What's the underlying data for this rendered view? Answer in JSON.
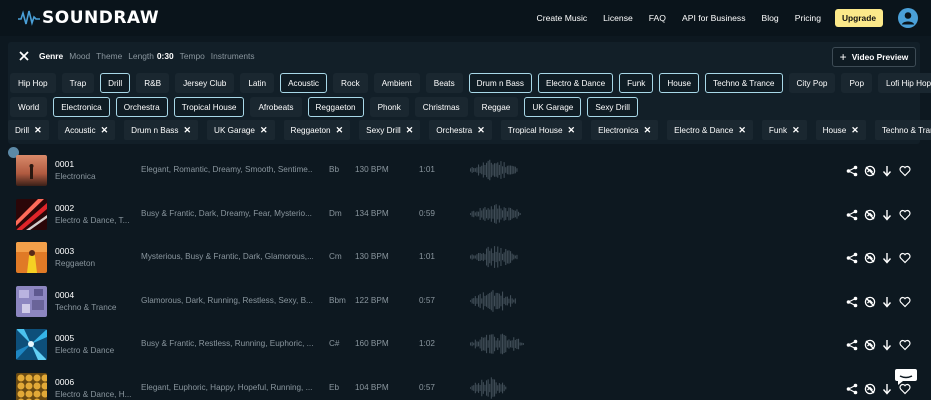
{
  "header": {
    "logo_text": "SOUNDRAW",
    "nav": [
      "Create Music",
      "License",
      "FAQ",
      "API for Business",
      "Blog",
      "Pricing"
    ],
    "upgrade_label": "Upgrade"
  },
  "filter": {
    "tabs": [
      "Genre",
      "Mood",
      "Theme",
      "Length",
      "Tempo",
      "Instruments"
    ],
    "length_value": "0:30",
    "video_preview_label": "Video Preview",
    "genre_row1": [
      {
        "label": "Hip Hop",
        "selected": false
      },
      {
        "label": "Trap",
        "selected": false
      },
      {
        "label": "Drill",
        "selected": true
      },
      {
        "label": "R&B",
        "selected": false
      },
      {
        "label": "Jersey Club",
        "selected": false
      },
      {
        "label": "Latin",
        "selected": false
      },
      {
        "label": "Acoustic",
        "selected": true
      },
      {
        "label": "Rock",
        "selected": false
      },
      {
        "label": "Ambient",
        "selected": false
      },
      {
        "label": "Beats",
        "selected": false
      },
      {
        "label": "Drum n Bass",
        "selected": true
      },
      {
        "label": "Electro & Dance",
        "selected": true
      },
      {
        "label": "Funk",
        "selected": true
      },
      {
        "label": "House",
        "selected": true
      },
      {
        "label": "Techno & Trance",
        "selected": true
      },
      {
        "label": "City Pop",
        "selected": false
      },
      {
        "label": "Pop",
        "selected": false
      },
      {
        "label": "Lofi Hip Hop",
        "selected": false
      }
    ],
    "genre_row2": [
      {
        "label": "World",
        "selected": false
      },
      {
        "label": "Electronica",
        "selected": true
      },
      {
        "label": "Orchestra",
        "selected": true
      },
      {
        "label": "Tropical House",
        "selected": true
      },
      {
        "label": "Afrobeats",
        "selected": false
      },
      {
        "label": "Reggaeton",
        "selected": true
      },
      {
        "label": "Phonk",
        "selected": false
      },
      {
        "label": "Christmas",
        "selected": false
      },
      {
        "label": "Reggae",
        "selected": false
      },
      {
        "label": "UK Garage",
        "selected": true
      },
      {
        "label": "Sexy Drill",
        "selected": true
      }
    ]
  },
  "active_filters": [
    "Drill",
    "Acoustic",
    "Drum n Bass",
    "UK Garage",
    "Reggaeton",
    "Sexy Drill",
    "Orchestra",
    "Tropical House",
    "Electronica",
    "Electro & Dance",
    "Funk",
    "House",
    "Techno & Trance"
  ],
  "tracks": [
    {
      "num": "0001",
      "genre": "Electronica",
      "moods": "Elegant, Romantic, Dreamy, Smooth, Sentime...",
      "key": "Bb",
      "bpm": "130 BPM",
      "length": "1:01",
      "thumb": "t1"
    },
    {
      "num": "0002",
      "genre": "Electro & Dance, T...",
      "moods": "Busy & Frantic, Dark, Dreamy, Fear, Mysterio...",
      "key": "Dm",
      "bpm": "134 BPM",
      "length": "0:59",
      "thumb": "t2"
    },
    {
      "num": "0003",
      "genre": "Reggaeton",
      "moods": "Mysterious, Busy & Frantic, Dark, Glamorous,...",
      "key": "Cm",
      "bpm": "130 BPM",
      "length": "1:01",
      "thumb": "t3"
    },
    {
      "num": "0004",
      "genre": "Techno & Trance",
      "moods": "Glamorous, Dark, Running, Restless, Sexy, B...",
      "key": "Bbm",
      "bpm": "122 BPM",
      "length": "0:57",
      "thumb": "t4"
    },
    {
      "num": "0005",
      "genre": "Electro & Dance",
      "moods": "Busy & Frantic, Restless, Running, Euphoric, ...",
      "key": "C#",
      "bpm": "160 BPM",
      "length": "1:02",
      "thumb": "t5"
    },
    {
      "num": "0006",
      "genre": "Electro & Dance, H...",
      "moods": "Elegant, Euphoric, Happy, Hopeful, Running, ...",
      "key": "Eb",
      "bpm": "104 BPM",
      "length": "0:57",
      "thumb": "t6"
    }
  ],
  "colors": {
    "background": "#0d1820",
    "upgrade": "#fce98a",
    "selected_chip_border": "#a8d8e8",
    "waveform": "#3f4c56",
    "accent_user": "#4aa0d8"
  }
}
